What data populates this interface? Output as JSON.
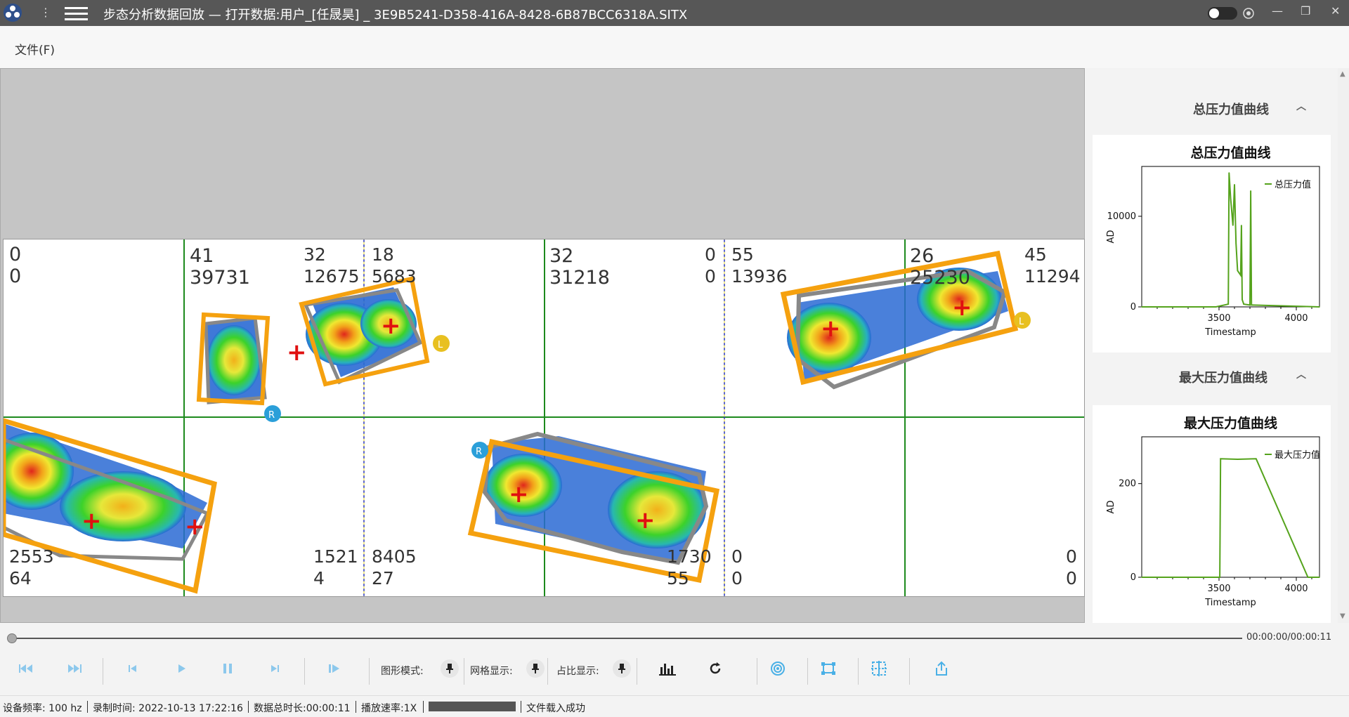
{
  "window": {
    "title": "步态分析数据回放 — 打开数据:用户_[任晟昊] _ 3E9B5241-D358-416A-8428-6B87BCC6318A.SITX",
    "dots": "⋮",
    "minimize": "—",
    "restore": "❐",
    "close": "✕"
  },
  "menu": {
    "file": "文件(F)"
  },
  "grid_cells": {
    "r0c0": "0\n0",
    "r0c1a": "41\n39731",
    "r0c1b": "32\n12675",
    "r0c2": "18\n5683",
    "r0c3a": "32\n31218",
    "r0c3b": "0\n0",
    "r0c4": "55\n13936",
    "r0c5a": "26\n25230",
    "r0c5b": "45\n11294",
    "r1c0": "2553\n64",
    "r1c1b": "1521\n4",
    "r1c2": "8405\n27",
    "r1c3b": "1730\n55",
    "r1c4": "0\n0",
    "r1c5b": "0\n0"
  },
  "foot_labels": {
    "l1": "L",
    "r1": "R",
    "r2": "R",
    "l2": "L"
  },
  "side": {
    "total_header": "总压力值曲线",
    "max_header": "最大压力值曲线"
  },
  "chart_data": [
    {
      "type": "line",
      "title": "总压力值曲线",
      "xlabel": "Timestamp",
      "ylabel": "AD",
      "xlim": [
        3000,
        4150
      ],
      "ylim": [
        0,
        15500
      ],
      "x_ticks": [
        3500,
        4000
      ],
      "y_ticks": [
        0,
        10000
      ],
      "legend": "top-right",
      "series": [
        {
          "name": "总压力值",
          "color": "#55a31c",
          "x": [
            3000,
            3480,
            3560,
            3565,
            3575,
            3590,
            3600,
            3610,
            3620,
            3640,
            3645,
            3650,
            3660,
            3700,
            3705,
            3710,
            3720,
            4150
          ],
          "y": [
            0,
            0,
            300,
            14800,
            12000,
            9000,
            13500,
            7000,
            4000,
            3500,
            9000,
            800,
            300,
            200,
            12800,
            200,
            200,
            0
          ]
        }
      ]
    },
    {
      "type": "line",
      "title": "最大压力值曲线",
      "xlabel": "Timestamp",
      "ylabel": "AD",
      "xlim": [
        3000,
        4150
      ],
      "ylim": [
        0,
        300
      ],
      "x_ticks": [
        3500,
        4000
      ],
      "y_ticks": [
        0,
        200
      ],
      "legend": "top-right",
      "series": [
        {
          "name": "最大压力值",
          "color": "#55a31c",
          "x": [
            3000,
            3505,
            3510,
            3620,
            3740,
            4075,
            4150
          ],
          "y": [
            0,
            0,
            253,
            252,
            253,
            0,
            0
          ]
        }
      ]
    }
  ],
  "playback": {
    "time": "00:00:00/00:00:11"
  },
  "toolbar": {
    "shape_mode": "图形模式:",
    "grid_display": "网格显示:",
    "ratio_display": "占比显示:"
  },
  "status": {
    "freq": "设备频率: 100 hz",
    "rec_time": "录制时间: 2022-10-13 17:22:16",
    "duration": "数据总时长:00:00:11",
    "speed": "播放速率:1X",
    "msg": "文件载入成功"
  },
  "colors": {
    "accent": "#2b9fd9",
    "footprint_box": "#f5a10f",
    "grid_line": "#1d8a1d",
    "curve": "#55a31c"
  }
}
